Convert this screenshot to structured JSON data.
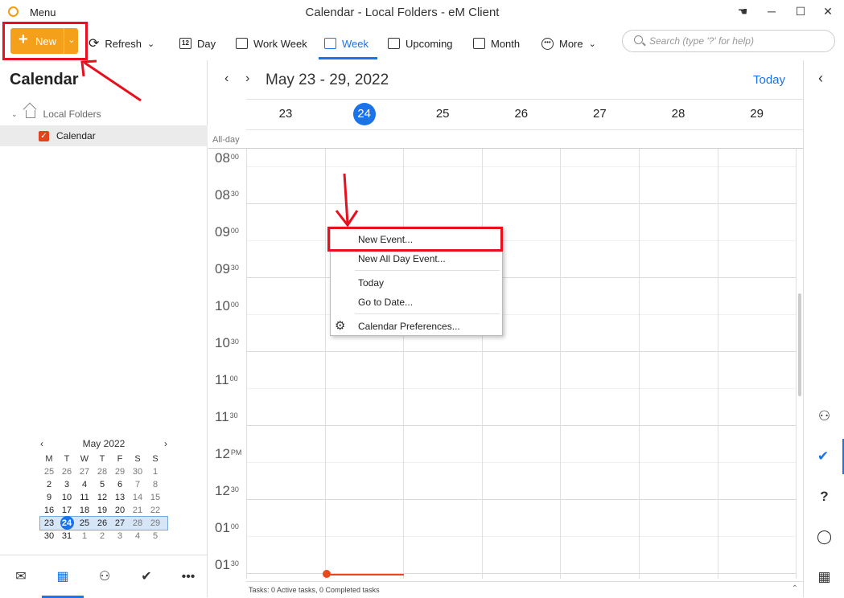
{
  "window": {
    "title": "Calendar - Local Folders - eM Client",
    "menu_label": "Menu"
  },
  "toolbar": {
    "new_label": "New",
    "refresh_label": "Refresh",
    "views": [
      "Day",
      "Work Week",
      "Week",
      "Upcoming",
      "Month",
      "More"
    ],
    "active_view": "Week",
    "search_placeholder": "Search (type '?' for help)",
    "day_icon_text": "12"
  },
  "sidebar": {
    "title": "Calendar",
    "tree": {
      "folder": "Local Folders",
      "calendar": "Calendar",
      "calendar_color": "#e0451b"
    },
    "mini_calendar": {
      "month": "May 2022",
      "weekdays": [
        "M",
        "T",
        "W",
        "T",
        "F",
        "S",
        "S"
      ],
      "weeks": [
        [
          "25",
          "26",
          "27",
          "28",
          "29",
          "30",
          "1"
        ],
        [
          "2",
          "3",
          "4",
          "5",
          "6",
          "7",
          "8"
        ],
        [
          "9",
          "10",
          "11",
          "12",
          "13",
          "14",
          "15"
        ],
        [
          "16",
          "17",
          "18",
          "19",
          "20",
          "21",
          "22"
        ],
        [
          "23",
          "24",
          "25",
          "26",
          "27",
          "28",
          "29"
        ],
        [
          "30",
          "31",
          "1",
          "2",
          "3",
          "4",
          "5"
        ]
      ],
      "today": "24"
    },
    "bottom_nav": [
      "mail-icon",
      "calendar-icon",
      "contacts-icon",
      "tasks-icon",
      "more-icon"
    ]
  },
  "calendar": {
    "date_range": "May 23 - 29, 2022",
    "today_label": "Today",
    "days": [
      "23",
      "24",
      "25",
      "26",
      "27",
      "28",
      "29"
    ],
    "today_day": "24",
    "allday_label": "All-day",
    "times": [
      {
        "h": "08",
        "m": "00"
      },
      {
        "h": "08",
        "m": "30"
      },
      {
        "h": "09",
        "m": "00"
      },
      {
        "h": "09",
        "m": "30"
      },
      {
        "h": "10",
        "m": "00"
      },
      {
        "h": "10",
        "m": "30"
      },
      {
        "h": "11",
        "m": "00"
      },
      {
        "h": "11",
        "m": "30"
      },
      {
        "h": "12",
        "m": "PM"
      },
      {
        "h": "12",
        "m": "30"
      },
      {
        "h": "01",
        "m": "00"
      },
      {
        "h": "01",
        "m": "30"
      }
    ],
    "status_text": "Tasks: 0 Active tasks, 0 Completed tasks",
    "accent": "#1a73e8",
    "now_color": "#e8491d"
  },
  "context_menu": {
    "items": [
      "New Event...",
      "New All Day Event...",
      "Today",
      "Go to Date...",
      "Calendar Preferences..."
    ]
  },
  "right_rail": [
    "contacts-icon",
    "tasks-icon",
    "help-icon",
    "chat-icon",
    "agenda-icon"
  ]
}
